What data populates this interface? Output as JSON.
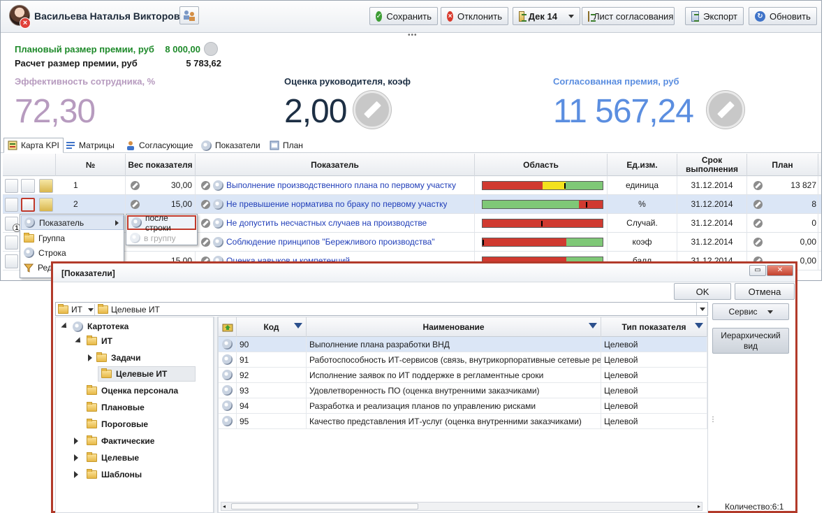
{
  "header": {
    "user_name": "Васильева Наталья Викторовна",
    "buttons": {
      "save": "Сохранить",
      "reject": "Отклонить",
      "period": "Дек 14",
      "approval_sheet": "Лист согласования",
      "export": "Экспорт",
      "refresh": "Обновить"
    }
  },
  "summary": {
    "planned_label": "Плановый размер премии, руб",
    "planned_value": "8 000,00",
    "calc_label": "Расчет размер премии, руб",
    "calc_value": "5 783,62",
    "kpi": [
      {
        "title": "Эффективность сотрудника, %",
        "value": "72,30",
        "color": "#b79bbf"
      },
      {
        "title": "Оценка руководителя, коэф",
        "value": "2,00",
        "color": "#1d2f44"
      },
      {
        "title": "Согласованная премия, руб",
        "value": "11 567,24",
        "color": "#5b8ee0"
      }
    ],
    "planned_color": "#1e8a2a"
  },
  "tabs": [
    "Карта KPI",
    "Матрицы",
    "Согласующие",
    "Показатели",
    "План"
  ],
  "kpi_grid": {
    "columns": [
      "№",
      "Вес показателя",
      "Показатель",
      "Область",
      "Ед.изм.",
      "Срок выполнения",
      "План"
    ],
    "rows": [
      {
        "num": "1",
        "weight": "30,00",
        "name": "Выполнение производственного плана по первому участку",
        "unit": "единица",
        "deadline": "31.12.2014",
        "plan": "13 827"
      },
      {
        "num": "2",
        "weight": "15,00",
        "name": "Не превышение норматива по браку по первому участку",
        "unit": "%",
        "deadline": "31.12.2014",
        "plan": "8"
      },
      {
        "num": "",
        "weight": "",
        "name": "Не допустить несчастных случаев на производстве",
        "unit": "Случай.",
        "deadline": "31.12.2014",
        "plan": "0"
      },
      {
        "num": "",
        "weight": "",
        "name": "Соблюдение принципов \"Бережливого производства\"",
        "unit": "коэф",
        "deadline": "31.12.2014",
        "plan": "0,00"
      },
      {
        "num": "",
        "weight": "15,00",
        "name": "Оценка навыков и компетенций",
        "unit": "балл",
        "deadline": "31.12.2014",
        "plan": "0,00"
      }
    ],
    "badge_count": "1"
  },
  "context_menu": {
    "items": [
      "Показатель",
      "Группа",
      "Строка",
      "Ред"
    ],
    "submenu": [
      "после строки",
      "в группу"
    ]
  },
  "dialog": {
    "title": "[Показатели]",
    "ok": "OK",
    "cancel": "Отмена",
    "path": [
      "ИТ",
      "Целевые ИТ"
    ],
    "service": "Сервис",
    "hier_view": "Иерархический вид",
    "count": "Количество:6:1",
    "tree": [
      {
        "label": "Картотека"
      },
      {
        "label": "ИТ"
      },
      {
        "label": "Задачи"
      },
      {
        "label": "Целевые ИТ"
      },
      {
        "label": "Оценка персонала"
      },
      {
        "label": "Плановые"
      },
      {
        "label": "Пороговые"
      },
      {
        "label": "Фактические"
      },
      {
        "label": "Целевые"
      },
      {
        "label": "Шаблоны"
      }
    ],
    "grid_columns": [
      "Код",
      "Наименование",
      "Тип показателя"
    ],
    "grid_rows": [
      {
        "code": "90",
        "name": "Выполнение плана разработки ВНД",
        "type": "Целевой"
      },
      {
        "code": "91",
        "name": "Работоспособность ИТ-сервисов (связь, внутрикорпоративные сетевые ре",
        "type": "Целевой"
      },
      {
        "code": "92",
        "name": "Исполнение заявок по ИТ поддержке в регламентные сроки",
        "type": "Целевой"
      },
      {
        "code": "93",
        "name": "Удовлетворенность ПО (оценка внутренними заказчиками)",
        "type": "Целевой"
      },
      {
        "code": "94",
        "name": "Разработка и реализация планов по управлению рисками",
        "type": "Целевой"
      },
      {
        "code": "95",
        "name": "Качество представления ИТ-услуг (оценка внутренними заказчиками)",
        "type": "Целевой"
      }
    ]
  }
}
